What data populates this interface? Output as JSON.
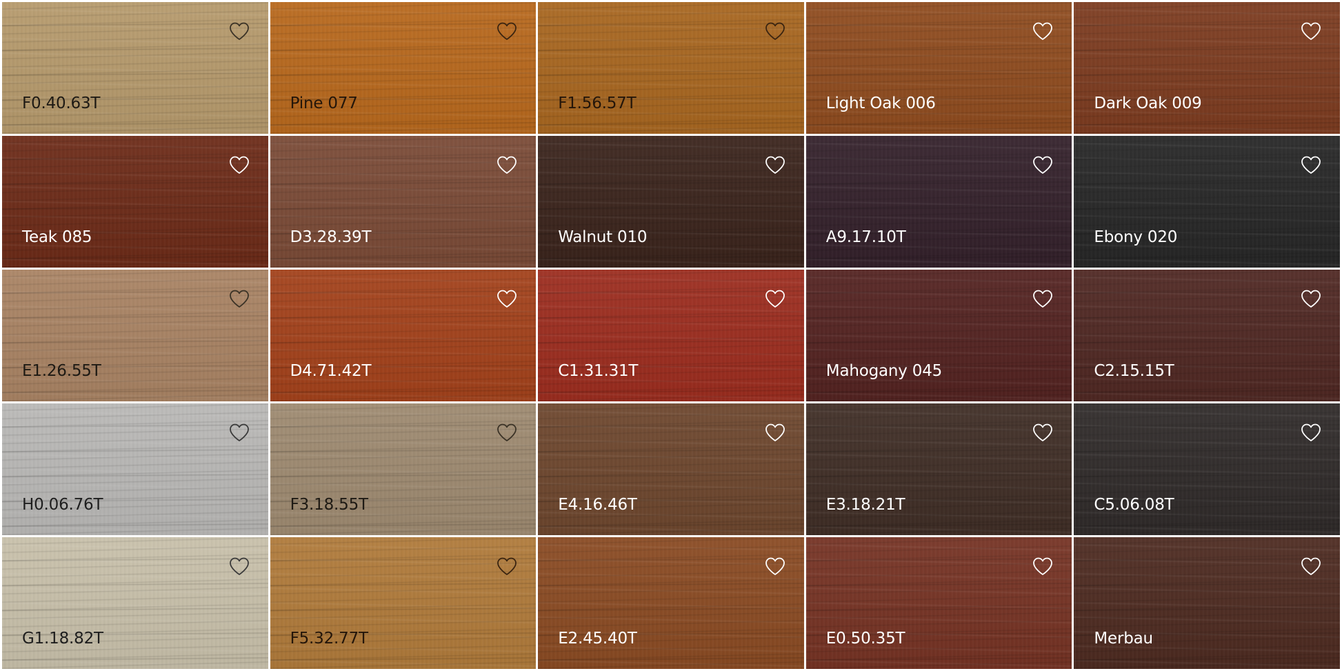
{
  "swatches": [
    {
      "name": "F0.40.63T",
      "color": "#b69a6c",
      "text_color": "#1e1a14",
      "icon": "heart-outline-icon",
      "icon_color": "#3a3226"
    },
    {
      "name": "Pine 077",
      "color": "#b8681c",
      "text_color": "#24160a",
      "icon": "heart-outline-icon",
      "icon_color": "#3a2410"
    },
    {
      "name": "F1.56.57T",
      "color": "#a8661f",
      "text_color": "#24160a",
      "icon": "heart-outline-icon",
      "icon_color": "#3a2410"
    },
    {
      "name": "Light Oak 006",
      "color": "#8f4b1e",
      "text_color": "#ffffff",
      "icon": "heart-outline-icon",
      "icon_color": "#ffffff"
    },
    {
      "name": "Dark Oak 009",
      "color": "#7c3b1f",
      "text_color": "#ffffff",
      "icon": "heart-outline-icon",
      "icon_color": "#ffffff"
    },
    {
      "name": "Teak 085",
      "color": "#6c2a17",
      "text_color": "#ffffff",
      "icon": "heart-outline-icon",
      "icon_color": "#ffffff"
    },
    {
      "name": "D3.28.39T",
      "color": "#7a4a36",
      "text_color": "#ffffff",
      "icon": "heart-outline-icon",
      "icon_color": "#ffffff"
    },
    {
      "name": "Walnut 010",
      "color": "#3a231b",
      "text_color": "#ffffff",
      "icon": "heart-outline-icon",
      "icon_color": "#ffffff"
    },
    {
      "name": "A9.17.10T",
      "color": "#33202a",
      "text_color": "#ffffff",
      "icon": "heart-outline-icon",
      "icon_color": "#ffffff"
    },
    {
      "name": "Ebony 020",
      "color": "#262626",
      "text_color": "#ffffff",
      "icon": "heart-outline-icon",
      "icon_color": "#ffffff"
    },
    {
      "name": "E1.26.55T",
      "color": "#a98363",
      "text_color": "#1e1a14",
      "icon": "heart-outline-icon",
      "icon_color": "#3a3226"
    },
    {
      "name": "D4.71.42T",
      "color": "#a3411a",
      "text_color": "#ffffff",
      "icon": "heart-outline-icon",
      "icon_color": "#ffffff"
    },
    {
      "name": "C1.31.31T",
      "color": "#9c2c1e",
      "text_color": "#ffffff",
      "icon": "heart-outline-icon",
      "icon_color": "#ffffff"
    },
    {
      "name": "Mahogany 045",
      "color": "#532220",
      "text_color": "#ffffff",
      "icon": "heart-outline-icon",
      "icon_color": "#ffffff"
    },
    {
      "name": "C2.15.15T",
      "color": "#4f2722",
      "text_color": "#ffffff",
      "icon": "heart-outline-icon",
      "icon_color": "#ffffff"
    },
    {
      "name": "H0.06.76T",
      "color": "#b9b8b6",
      "text_color": "#1e1e1e",
      "icon": "heart-outline-icon",
      "icon_color": "#3a3a3a"
    },
    {
      "name": "F3.18.55T",
      "color": "#9e8a70",
      "text_color": "#1e1a14",
      "icon": "heart-outline-icon",
      "icon_color": "#3a3226"
    },
    {
      "name": "E4.16.46T",
      "color": "#6d462d",
      "text_color": "#ffffff",
      "icon": "heart-outline-icon",
      "icon_color": "#ffffff"
    },
    {
      "name": "E3.18.21T",
      "color": "#3f2d25",
      "text_color": "#ffffff",
      "icon": "heart-outline-icon",
      "icon_color": "#ffffff"
    },
    {
      "name": "C5.06.08T",
      "color": "#2f2a29",
      "text_color": "#ffffff",
      "icon": "heart-outline-icon",
      "icon_color": "#ffffff"
    },
    {
      "name": "G1.18.82T",
      "color": "#c8c0aa",
      "text_color": "#1e1e1e",
      "icon": "heart-outline-icon",
      "icon_color": "#3a3a3a"
    },
    {
      "name": "F5.32.77T",
      "color": "#b07a3a",
      "text_color": "#24160a",
      "icon": "heart-outline-icon",
      "icon_color": "#3a2410"
    },
    {
      "name": "E2.45.40T",
      "color": "#8a4a22",
      "text_color": "#ffffff",
      "icon": "heart-outline-icon",
      "icon_color": "#ffffff"
    },
    {
      "name": "E0.50.35T",
      "color": "#753223",
      "text_color": "#ffffff",
      "icon": "heart-outline-icon",
      "icon_color": "#ffffff"
    },
    {
      "name": "Merbau",
      "color": "#4d2a20",
      "text_color": "#ffffff",
      "icon": "heart-outline-icon",
      "icon_color": "#ffffff"
    }
  ]
}
